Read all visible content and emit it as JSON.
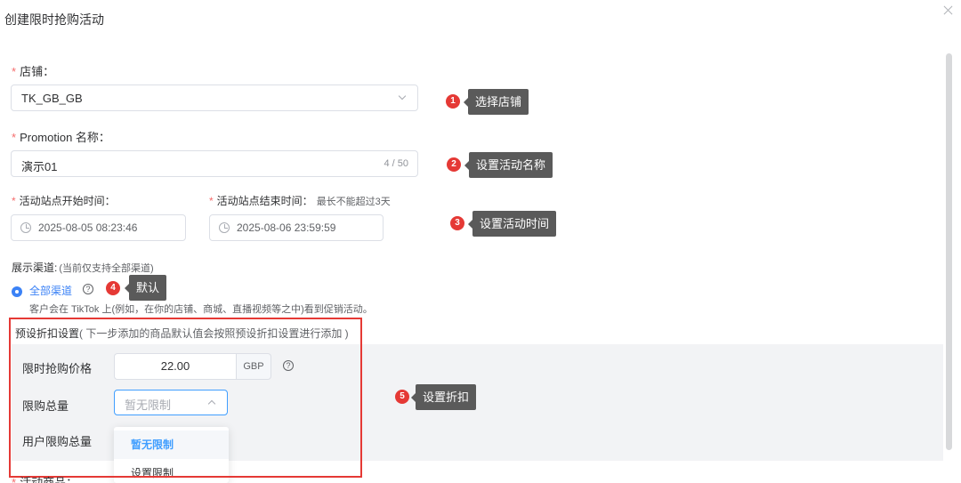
{
  "dialog": {
    "title": "创建限时抢购活动"
  },
  "shop": {
    "label": "店铺：",
    "value": "TK_GB_GB"
  },
  "promotion": {
    "label": "Promotion 名称：",
    "value": "演示01",
    "count": "4 / 50"
  },
  "start_time": {
    "label": "活动站点开始时间：",
    "value": "2025-08-05 08:23:46"
  },
  "end_time": {
    "label": "活动站点结束时间：",
    "hint": "最长不能超过3天",
    "value": "2025-08-06 23:59:59"
  },
  "channel": {
    "label": "展示渠道:",
    "hint": "(当前仅支持全部渠道)",
    "option": "全部渠道",
    "description": "客户会在 TikTok 上(例如，在你的店铺、商城、直播视频等之中)看到促销活动。"
  },
  "preset": {
    "title": "预设折扣设置",
    "subtitle": "( 下一步添加的商品默认值会按照预设折扣设置进行添加 )",
    "price_label": "限时抢购价格",
    "price_value": "22.00",
    "currency": "GBP",
    "limit_label": "限购总量",
    "limit_placeholder": "暂无限制",
    "user_limit_label": "用户限购总量",
    "dropdown_options": [
      "暂无限制",
      "设置限制"
    ]
  },
  "cut_label": "活动商品：",
  "annotations": [
    {
      "num": "1",
      "text": "选择店铺"
    },
    {
      "num": "2",
      "text": "设置活动名称"
    },
    {
      "num": "3",
      "text": "设置活动时间"
    },
    {
      "num": "4",
      "text": "默认"
    },
    {
      "num": "5",
      "text": "设置折扣"
    }
  ],
  "colors": {
    "primary": "#409eff",
    "required": "#f56c6c",
    "annotation_red": "#e53935",
    "callout_bg": "#5a5a5a"
  }
}
